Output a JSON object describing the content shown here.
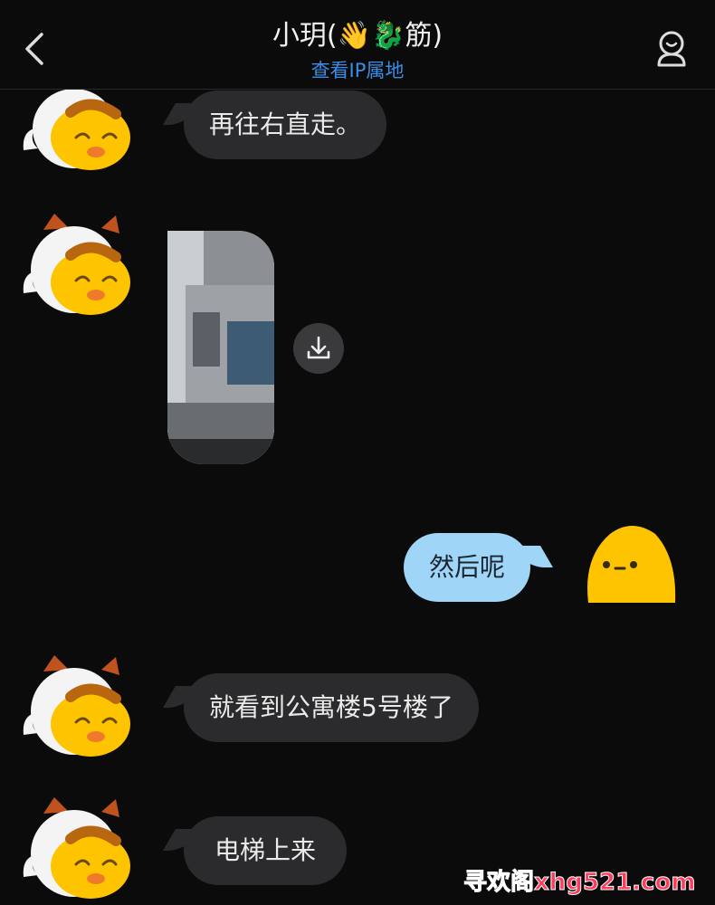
{
  "header": {
    "title": "小玥(👋🐉筋)",
    "subtitle": "查看IP属地"
  },
  "messages": [
    {
      "side": "left",
      "type": "text",
      "text": "再往右直走。"
    },
    {
      "side": "left",
      "type": "image"
    },
    {
      "side": "right",
      "type": "text",
      "text": "然后呢"
    },
    {
      "side": "left",
      "type": "text",
      "text": "就看到公寓楼5号楼了"
    },
    {
      "side": "left",
      "type": "text",
      "text": "电梯上来"
    }
  ],
  "icons": {
    "back": "chevron-left-icon",
    "profile": "user-profile-icon",
    "download": "download-icon"
  },
  "watermark": "寻欢阁xhg521.com",
  "colors": {
    "background": "#0b0b0c",
    "incoming_bubble": "#2b2b2d",
    "outgoing_bubble": "#9fd6f7",
    "link": "#3a8ee8",
    "watermark": "#ff3b5c"
  }
}
